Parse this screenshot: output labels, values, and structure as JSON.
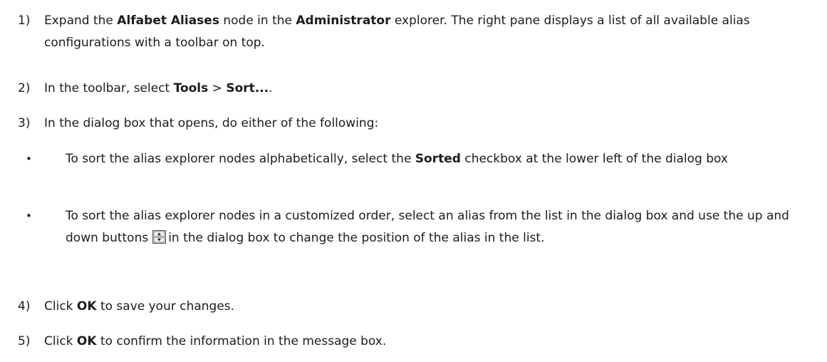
{
  "steps": [
    {
      "num": "1)",
      "t1": "Expand the ",
      "b1": "Alfabet Aliases",
      "t2": " node in the ",
      "b2": "Administrator",
      "t3": " explorer. The right pane displays a list of all available alias configurations with a toolbar on top."
    },
    {
      "num": "2)",
      "t1": "In the toolbar, select ",
      "b1": "Tools",
      "t2": " > ",
      "b2": "Sort...",
      "t3": "."
    },
    {
      "num": "3)",
      "t1": "In the dialog box that opens, do either of the following:"
    },
    {
      "num": "4)",
      "t1": "Click ",
      "b1": "OK",
      "t2": " to save your changes."
    },
    {
      "num": "5)",
      "t1": "Click ",
      "b1": "OK",
      "t2": " to confirm the information in the message box."
    }
  ],
  "bullets": [
    {
      "dot": "•",
      "t1": "To sort the alias explorer nodes alphabetically, select the ",
      "b1": "Sorted",
      "t2": " checkbox at the lower left of the dialog box"
    },
    {
      "dot": "•",
      "t1": "To sort the alias explorer nodes in a customized order, select an alias from the list in the dialog box and use the up and down buttons",
      "icon": "up-down-buttons-icon",
      "t2": "in the dialog box to change the position of the alias in the list."
    }
  ]
}
